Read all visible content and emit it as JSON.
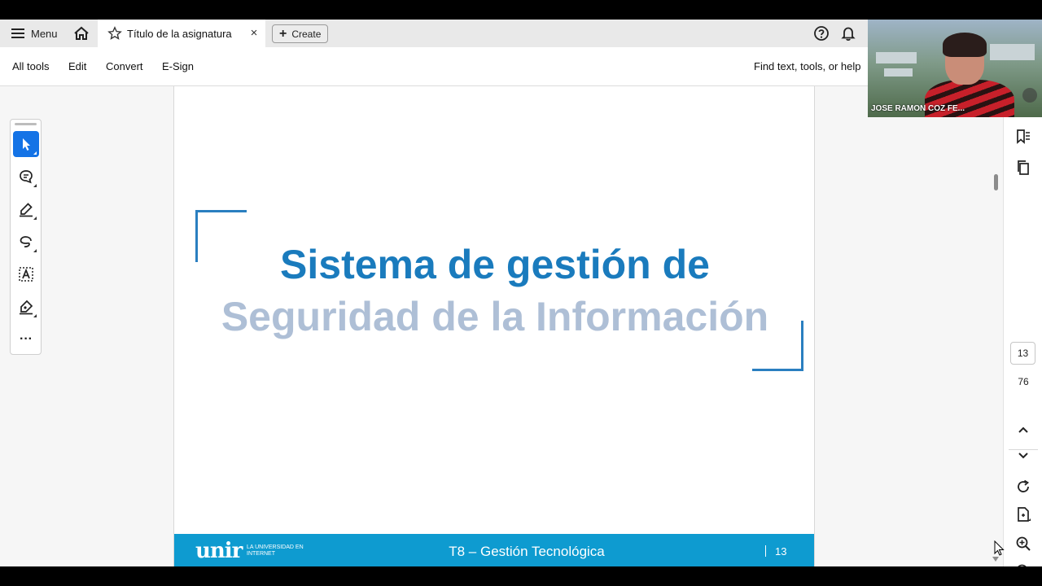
{
  "tabbar": {
    "menu_label": "Menu",
    "doc_tab_title": "Título de la asignatura",
    "close_symbol": "×",
    "create_label": "Create",
    "create_plus": "+"
  },
  "toolbar": {
    "items": [
      "All tools",
      "Edit",
      "Convert",
      "E-Sign"
    ],
    "find_label": "Find text, tools, or help"
  },
  "tools": [
    "select-arrow-icon",
    "comment-icon",
    "highlighter-icon",
    "lasso-draw-icon",
    "text-select-icon",
    "sign-icon",
    "more-icon"
  ],
  "tools_more_symbol": "···",
  "slide": {
    "title_line1": "Sistema de gestión de",
    "title_line2": "Seguridad de la Información",
    "footer_logo": "unir",
    "footer_logo_sub": "LA UNIVERSIDAD EN INTERNET",
    "footer_title": "T8 – Gestión Tecnológica",
    "footer_page": "13",
    "accent_color": "#1a7bbd",
    "footer_color": "#0e9bd0"
  },
  "page_nav": {
    "current_page": "13",
    "total_pages": "76"
  },
  "webcam": {
    "participant_name": "JOSE RAMON COZ FE..."
  }
}
